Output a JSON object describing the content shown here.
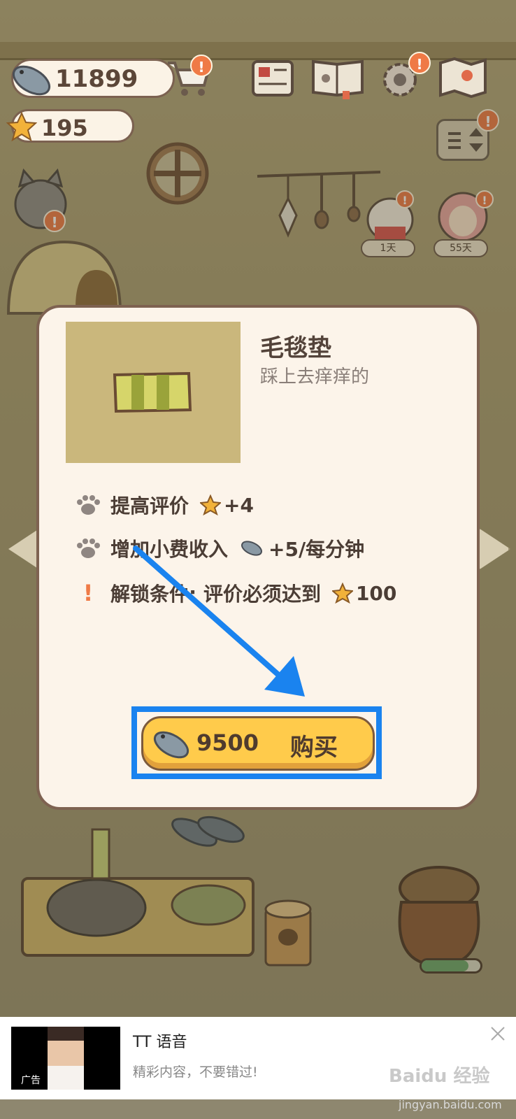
{
  "hud": {
    "fish_count": "11899",
    "star_count": "195",
    "badge_mark": "!"
  },
  "cats": [
    {
      "days": "1天"
    },
    {
      "days": "55天"
    }
  ],
  "item": {
    "name": "毛毯垫",
    "description": "踩上去痒痒的",
    "stats": [
      {
        "label": "提高评价",
        "value": "+4"
      },
      {
        "label": "增加小费收入",
        "value": "+5/每分钟"
      }
    ],
    "unlock": {
      "mark": "!",
      "label": "解锁条件: 评价必须达到",
      "value": "100"
    }
  },
  "buy": {
    "price": "9500",
    "label": "购买"
  },
  "ad": {
    "title": "TT 语音",
    "subtitle": "精彩内容，不要错过!",
    "tag": "广告"
  },
  "watermark": {
    "text": "Baidu 经验",
    "sub": "jingyan.baidu.com"
  },
  "colors": {
    "accent_blue": "#1a83ef",
    "button_yellow": "#ffcb4b",
    "badge_orange": "#ef7a46"
  }
}
